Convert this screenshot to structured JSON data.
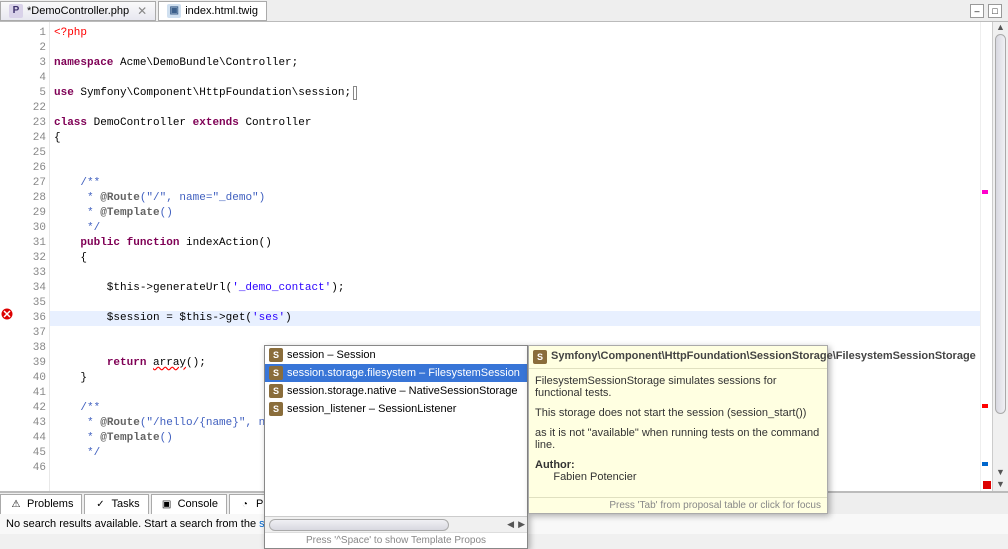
{
  "tabs": {
    "active": {
      "label": "*DemoController.php"
    },
    "other": {
      "label": "index.html.twig"
    }
  },
  "gutter": {
    "lines": [
      "1",
      "2",
      "3",
      "4",
      "5",
      "22",
      "23",
      "24",
      "25",
      "26",
      "27",
      "28",
      "29",
      "30",
      "31",
      "32",
      "33",
      "34",
      "35",
      "36",
      "37",
      "38",
      "39",
      "40",
      "41",
      "42",
      "43",
      "44",
      "45",
      "46"
    ]
  },
  "code": {
    "l1_open": "<?php",
    "l3_kw": "namespace",
    "l3_rest": " Acme\\DemoBundle\\Controller;",
    "l5_kw": "use",
    "l5_rest": " Symfony\\Component\\HttpFoundation\\session;",
    "l23_kw1": "class",
    "l23_name": " DemoController ",
    "l23_kw2": "extends",
    "l23_parent": " Controller",
    "l24": "{",
    "l27": "    /**",
    "l28_pre": "     * ",
    "l28_ann": "@Route",
    "l28_args": "(\"/\", name=\"_demo\")",
    "l29_pre": "     * ",
    "l29_ann": "@Template",
    "l29_args": "()",
    "l30": "     */",
    "l31_pre": "    ",
    "l31_kw1": "public",
    "l31_kw2": " function",
    "l31_name": " indexAction()",
    "l32": "    {",
    "l34_pre": "        $this->generateUrl(",
    "l34_str": "'_demo_contact'",
    "l34_post": ");",
    "l36_pre": "        $session = $this->get(",
    "l36_str": "'ses'",
    "l36_post": ")",
    "l39_pre": "        ",
    "l39_kw": "return",
    "l39_post": " ",
    "l39_err": "array",
    "l39_end": "();",
    "l40": "    }",
    "l42": "    /**",
    "l43_pre": "     * ",
    "l43_ann": "@Route",
    "l43_args": "(\"/hello/{name}\", n",
    "l44_pre": "     * ",
    "l44_ann": "@Template",
    "l44_args": "()",
    "l45": "     */"
  },
  "autocomplete": {
    "items": [
      {
        "label": "session – Session"
      },
      {
        "label": "session.storage.filesystem – FilesystemSession"
      },
      {
        "label": "session.storage.native – NativeSessionStorage"
      },
      {
        "label": "session_listener – SessionListener"
      }
    ],
    "footer": "Press '^Space' to show Template Propos"
  },
  "doc": {
    "title": "Symfony\\Component\\HttpFoundation\\SessionStorage\\FilesystemSessionStorage",
    "p1": "FilesystemSessionStorage simulates sessions for functional tests.",
    "p2": "This storage does not start the session (session_start())",
    "p3": "as it is not \"available\" when running tests on the command line.",
    "author_label": "Author:",
    "author": "Fabien Potencier",
    "footer": "Press 'Tab' from proposal table or click for focus"
  },
  "bottom_tabs": {
    "problems": "Problems",
    "tasks": "Tasks",
    "console": "Console",
    "progress": "Progre"
  },
  "status": {
    "text_pre": "No search results available. Start a search from the ",
    "link": "search dialog",
    "text_post": "..."
  }
}
